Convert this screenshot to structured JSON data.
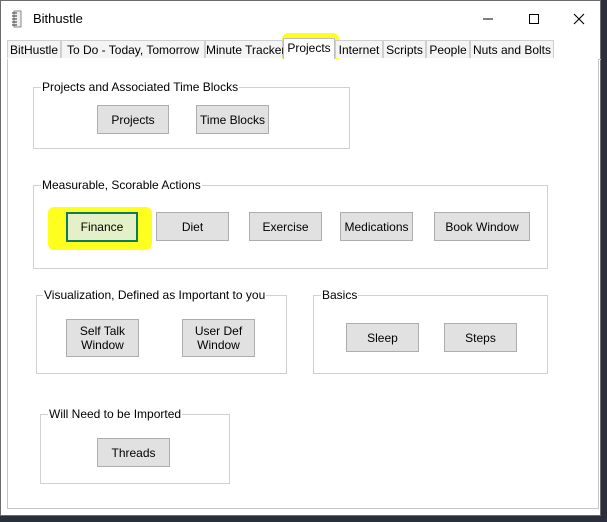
{
  "window": {
    "title": "Bithustle",
    "app_icon": "spiral-notebook-icon"
  },
  "tabs": [
    {
      "label": "BitHustle"
    },
    {
      "label": "To Do - Today, Tomorrow"
    },
    {
      "label": "Minute Tracker"
    },
    {
      "label": "Projects",
      "selected": true
    },
    {
      "label": "Internet"
    },
    {
      "label": "Scripts"
    },
    {
      "label": "People"
    },
    {
      "label": "Nuts and Bolts"
    }
  ],
  "groups": {
    "projects": {
      "title": "Projects and Associated Time Blocks",
      "buttons": [
        "Projects",
        "Time Blocks"
      ]
    },
    "measurable": {
      "title": "Measurable, Scorable Actions",
      "buttons": [
        "Finance",
        "Diet",
        "Exercise",
        "Medications",
        "Book Window"
      ]
    },
    "visualization": {
      "title": "Visualization, Defined as Important to you",
      "buttons": [
        "Self Talk Window",
        "User Def Window"
      ]
    },
    "basics": {
      "title": "Basics",
      "buttons": [
        "Sleep",
        "Steps"
      ]
    },
    "imported": {
      "title": "Will Need to be Imported",
      "buttons": [
        "Threads"
      ]
    }
  },
  "colors": {
    "highlight": "#ffff1f",
    "focus_border": "#0f7a5a"
  }
}
